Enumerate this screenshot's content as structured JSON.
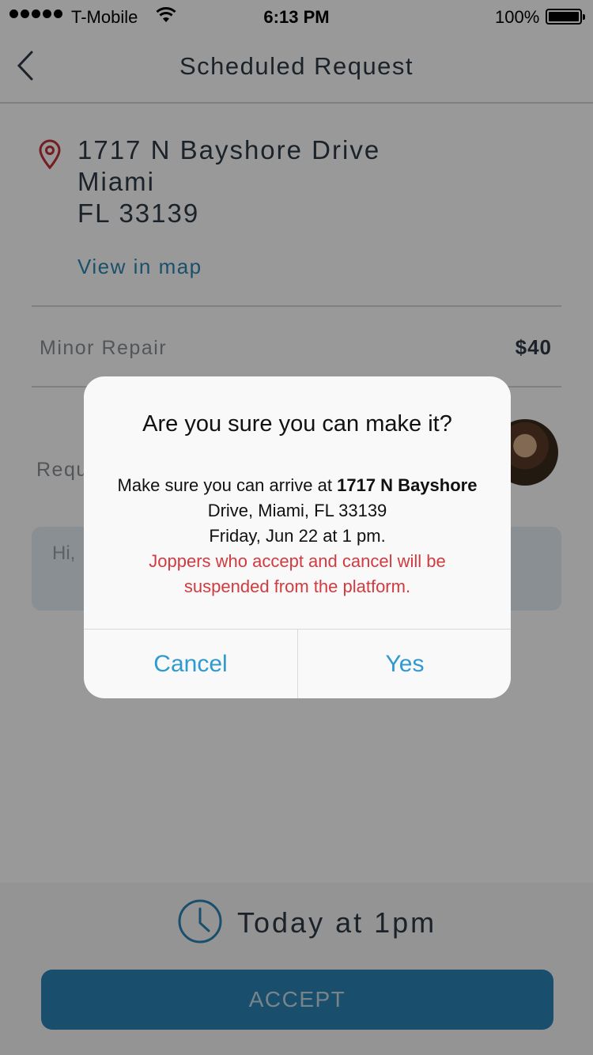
{
  "status_bar": {
    "carrier": "T-Mobile",
    "time": "6:13 PM",
    "battery_percent": "100%"
  },
  "nav": {
    "title": "Scheduled Request",
    "back_icon": "chevron-left-icon"
  },
  "request": {
    "address_line1": "1717 N Bayshore Drive",
    "address_line2": "Miami",
    "address_line3": "FL 33139",
    "map_link": "View in map",
    "service": "Minor Repair",
    "price": "$40",
    "requested_label_visible": "Requ",
    "message_visible_start": "Hi,",
    "message_visible_end": "!"
  },
  "bottom": {
    "schedule_time": "Today at 1pm",
    "accept_label": "ACCEPT"
  },
  "dialog": {
    "title": "Are you sure you can make it?",
    "body_prefix": "Make sure you can arrive at ",
    "body_address_a": "1717 N Bayshore",
    "body_address_b": "Drive, Miami, FL 33139",
    "body_date": "Friday, Jun 22 at 1 pm.",
    "warning_line1": "Joppers who accept and cancel will be",
    "warning_line2": "suspended from the platform.",
    "cancel_label": "Cancel",
    "yes_label": "Yes"
  },
  "colors": {
    "accent": "#2e86b3",
    "accept_button": "#2a83b5",
    "warning": "#d33a3f",
    "pin": "#c0323a"
  }
}
